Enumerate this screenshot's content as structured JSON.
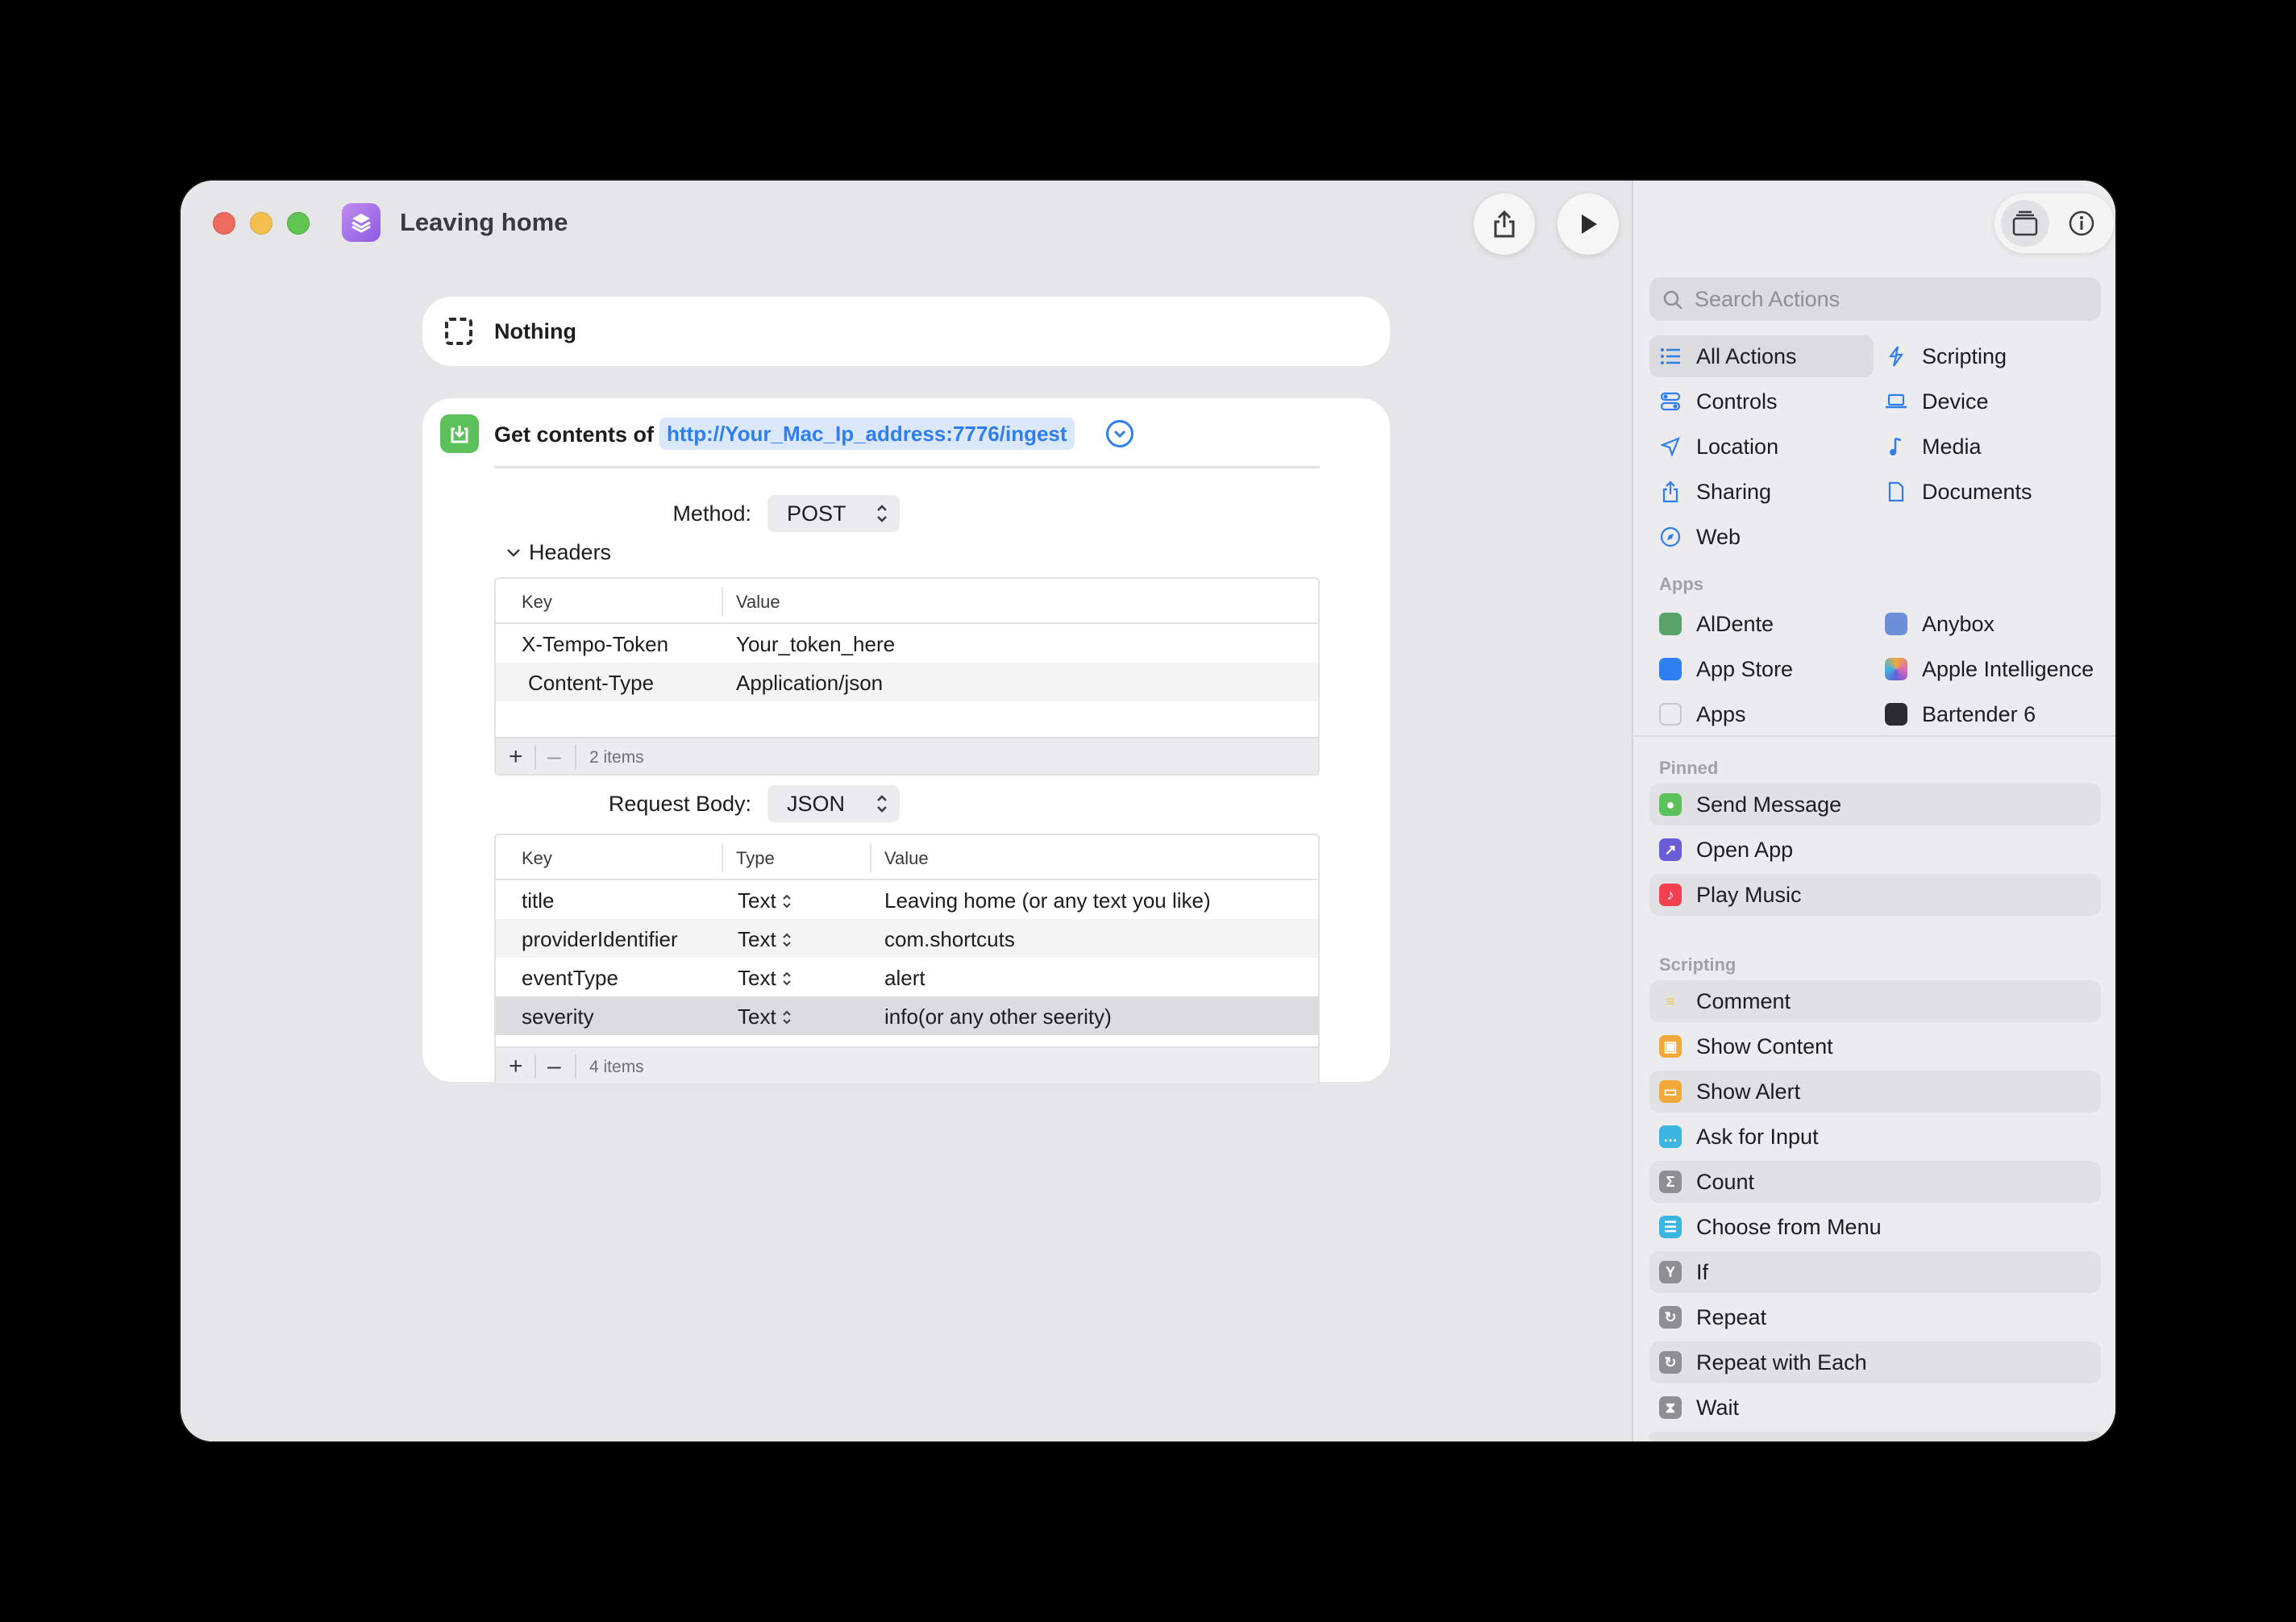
{
  "window": {
    "title": "Leaving home"
  },
  "nothing_action": {
    "label": "Nothing"
  },
  "get_contents": {
    "label": "Get contents of",
    "url": "http://Your_Mac_Ip_address:7776/ingest",
    "method_label": "Method:",
    "method_value": "POST",
    "headers_label": "Headers",
    "headers_table": {
      "columns": [
        "Key",
        "Value"
      ],
      "rows": [
        {
          "key": "X-Tempo-Token",
          "value": "Your_token_here"
        },
        {
          "key": "Content-Type",
          "value": "Application/json"
        }
      ],
      "count": "2 items"
    },
    "body_label": "Request Body:",
    "body_value": "JSON",
    "body_table": {
      "columns": [
        "Key",
        "Type",
        "Value"
      ],
      "rows": [
        {
          "key": "title",
          "type": "Text",
          "value": "Leaving home (or any text you like)"
        },
        {
          "key": "providerIdentifier",
          "type": "Text",
          "value": "com.shortcuts"
        },
        {
          "key": "eventType",
          "type": "Text",
          "value": "alert"
        },
        {
          "key": "severity",
          "type": "Text",
          "value": "info(or any other seerity)"
        }
      ],
      "count": "4 items"
    }
  },
  "sidebar": {
    "search_placeholder": "Search Actions",
    "categories": [
      {
        "label": "All Actions",
        "icon": "list-icon"
      },
      {
        "label": "Scripting",
        "icon": "scripting-icon"
      },
      {
        "label": "Controls",
        "icon": "controls-icon"
      },
      {
        "label": "Device",
        "icon": "laptop-icon"
      },
      {
        "label": "Location",
        "icon": "location-arrow-icon"
      },
      {
        "label": "Media",
        "icon": "music-note-icon"
      },
      {
        "label": "Sharing",
        "icon": "share-icon"
      },
      {
        "label": "Documents",
        "icon": "document-icon"
      },
      {
        "label": "Web",
        "icon": "compass-icon"
      }
    ],
    "apps_heading": "Apps",
    "apps": [
      {
        "label": "AlDente",
        "color": "#5aa36a"
      },
      {
        "label": "Anybox",
        "color": "#6d8fd8"
      },
      {
        "label": "App Store",
        "color": "#2f7ef0"
      },
      {
        "label": "Apple Intelligence",
        "color": "#e06ab0"
      },
      {
        "label": "Apps",
        "color": "#9b9ba0"
      },
      {
        "label": "Bartender 6",
        "color": "#2c2c2e"
      }
    ],
    "pinned_heading": "Pinned",
    "pinned": [
      {
        "label": "Send Message",
        "color": "#5cc15a"
      },
      {
        "label": "Open App",
        "color": "#6a5cd6"
      },
      {
        "label": "Play Music",
        "color": "#f2404f"
      }
    ],
    "scripting_heading": "Scripting",
    "scripting": [
      {
        "label": "Comment",
        "color": "#f3c445"
      },
      {
        "label": "Show Content",
        "color": "#f2a93b"
      },
      {
        "label": "Show Alert",
        "color": "#f2a93b"
      },
      {
        "label": "Ask for Input",
        "color": "#3cb6e0"
      },
      {
        "label": "Count",
        "color": "#8e8e93"
      },
      {
        "label": "Choose from Menu",
        "color": "#3cb6e0"
      },
      {
        "label": "If",
        "color": "#8e8e93"
      },
      {
        "label": "Repeat",
        "color": "#8e8e93"
      },
      {
        "label": "Repeat with Each",
        "color": "#8e8e93"
      },
      {
        "label": "Wait",
        "color": "#8e8e93"
      }
    ]
  }
}
